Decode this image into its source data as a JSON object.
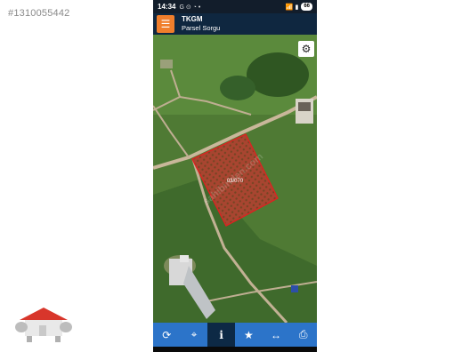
{
  "listing_id": "#1310055442",
  "status_bar": {
    "time": "14:34",
    "icons": "G ⊙ ◔ •",
    "signal": "📶 ▮",
    "battery": "66"
  },
  "header": {
    "menu_icon": "hamburger-icon",
    "title": "TKGM",
    "subtitle": "Parsel Sorgu"
  },
  "map": {
    "parcel_label": "03/070",
    "watermark": "sahibinden.com",
    "parcel_color": "#e02020",
    "layers_icon": "gear-icon"
  },
  "toolbar": {
    "items": [
      {
        "icon": "refresh-icon",
        "glyph": "⟳"
      },
      {
        "icon": "locate-icon",
        "glyph": "⌖"
      },
      {
        "icon": "info-icon",
        "glyph": "i"
      },
      {
        "icon": "star-icon",
        "glyph": "★"
      },
      {
        "icon": "measure-icon",
        "glyph": "↔"
      },
      {
        "icon": "print-icon",
        "glyph": "⎙"
      }
    ],
    "active_index": 2,
    "accent": "#2c74c9"
  }
}
